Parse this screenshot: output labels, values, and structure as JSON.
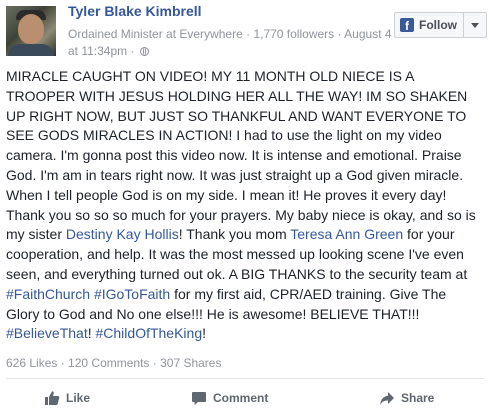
{
  "author": {
    "name": "Tyler Blake Kimbrell",
    "role": "Ordained Minister at Everywhere",
    "followers": "1,770 followers",
    "date": "August 4",
    "time": "at 11:34pm"
  },
  "follow": {
    "label": "Follow"
  },
  "post": {
    "l1": "MIRACLE CAUGHT ON VIDEO! MY 11 MONTH OLD NIECE IS A",
    "l2": "TROOPER WITH JESUS HOLDING HER ALL THE WAY! IM SO SHAKEN",
    "l3": "UP RIGHT NOW, BUT JUST SO THANKFUL AND WANT EVERYONE TO",
    "l4": "SEE GODS MIRACLES IN ACTION! I had to use the light on my video",
    "l5": "camera. I'm gonna post this video now. It is intense and emotional. Praise",
    "l6": "God. I'm am in tears right now. It was just straight up a God given miracle.",
    "l7": "When I tell people God is on my side. I mean it! He proves it every day!",
    "l8": "Thank you so so so much for your prayers. My baby niece is okay, and so is",
    "l9_a": "my sister ",
    "l9_link": "Destiny Kay Hollis",
    "l9_b": "! Thank you mom ",
    "l9_link2": "Teresa Ann Green",
    "l9_c": " for your",
    "l10": "cooperation, and help. It was the most messed up looking scene I've even",
    "l11": "seen, and everything turned out ok. A BIG THANKS to the security team at",
    "l12_tag1": "#FaithChurch",
    "l12_tag2": "#IGoToFaith",
    "l12_b": " for my first aid, CPR/AED training. Give The",
    "l13": "Glory to God and No one else!!! He is awesome! BELIEVE THAT!!!",
    "l14_tag1": "#BelieveThat",
    "l14_tag2": "#ChildOfTheKing",
    "l14_end": "!"
  },
  "stats": {
    "likes": "626 Likes",
    "comments": "120 Comments",
    "shares": "307 Shares"
  },
  "actions": {
    "like": "Like",
    "comment": "Comment",
    "share": "Share"
  },
  "colors": {
    "link": "#365899",
    "meta": "#90949c",
    "text": "#1d2129",
    "facebook_blue": "#3b5998"
  }
}
